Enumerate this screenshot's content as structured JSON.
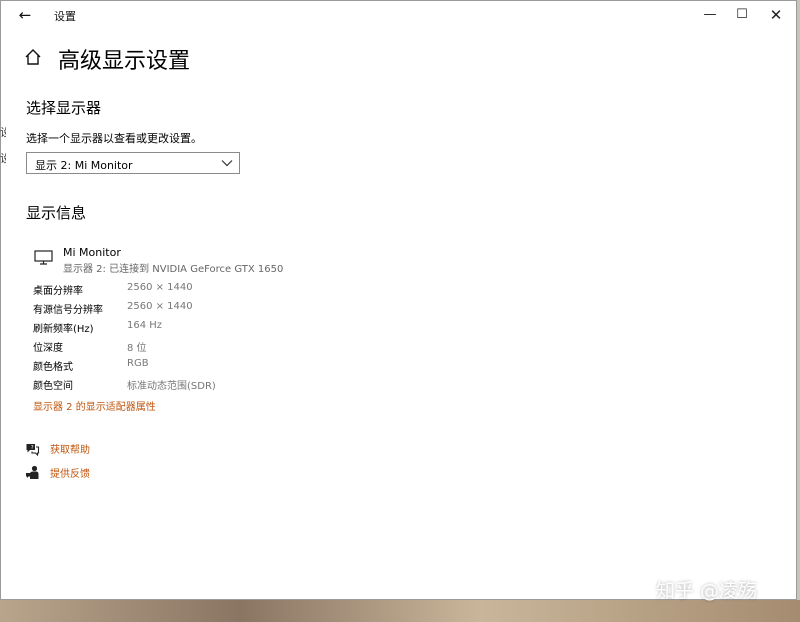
{
  "window": {
    "title": "设置"
  },
  "page": {
    "title": "高级显示设置"
  },
  "select_display": {
    "heading": "选择显示器",
    "hint": "选择一个显示器以查看或更改设置。",
    "selected": "显示 2: Mi Monitor"
  },
  "display_info": {
    "heading": "显示信息",
    "monitor_name": "Mi Monitor",
    "monitor_desc": "显示器 2: 已连接到 NVIDIA GeForce GTX 1650",
    "rows": [
      {
        "label": "桌面分辨率",
        "value": "2560 × 1440"
      },
      {
        "label": "有源信号分辨率",
        "value": "2560 × 1440"
      },
      {
        "label": "刷新频率(Hz)",
        "value": "164 Hz"
      },
      {
        "label": "位深度",
        "value": "8 位"
      },
      {
        "label": "颜色格式",
        "value": "RGB"
      },
      {
        "label": "颜色空间",
        "value": "标准动态范围(SDR)"
      }
    ],
    "adapter_link": "显示器 2 的显示适配器属性"
  },
  "help": {
    "get_help": "获取帮助",
    "feedback": "提供反馈"
  },
  "edge": {
    "char1": "设",
    "char2": "设"
  },
  "watermark": "知乎 @凌殇",
  "colors": {
    "link": "#c0560f",
    "secondary_text": "#777777"
  }
}
